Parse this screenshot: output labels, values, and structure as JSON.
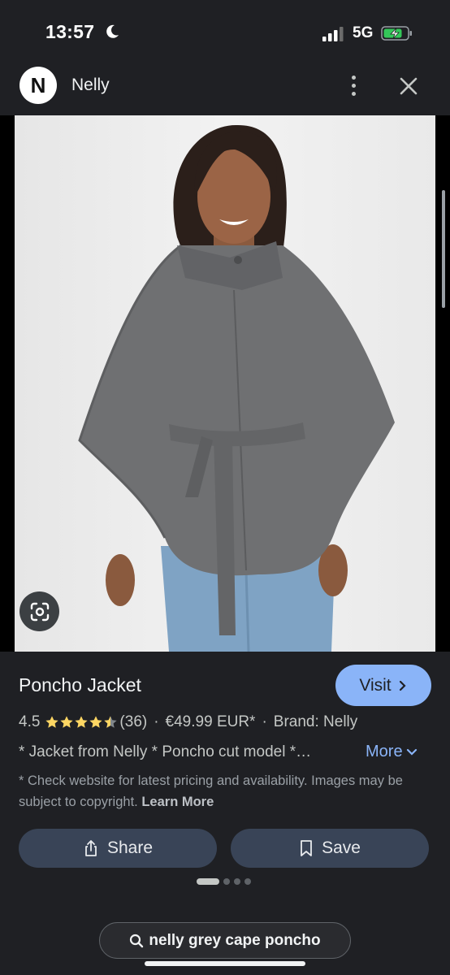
{
  "status_bar": {
    "time": "13:57",
    "network": "5G"
  },
  "header": {
    "logo_letter": "N",
    "site_name": "Nelly"
  },
  "product": {
    "title": "Poncho Jacket",
    "visit_label": "Visit",
    "rating": "4.5",
    "rating_value": 4.5,
    "review_count": "(36)",
    "price": "€49.99 EUR*",
    "brand": "Brand: Nelly",
    "separator": "·",
    "description": "* Jacket from Nelly * Poncho cut model *…",
    "more_label": "More",
    "disclaimer": "* Check website for latest pricing and availability. Images may be subject to copyright.",
    "learn_more": "Learn More"
  },
  "actions": {
    "share_label": "Share",
    "save_label": "Save"
  },
  "pager": {
    "total": 4,
    "active_index": 0
  },
  "search_chip": {
    "query": "nelly grey cape poncho"
  },
  "colors": {
    "background": "#1f2024",
    "accent": "#8ab4f8",
    "star": "#fdd663",
    "button": "#394457"
  },
  "icons": [
    "moon-icon",
    "signal-icon",
    "battery-charging-icon",
    "more-vert-icon",
    "close-icon",
    "lens-icon",
    "star-icon",
    "chevron-right-icon",
    "chevron-down-icon",
    "share-icon",
    "bookmark-icon",
    "search-icon"
  ]
}
